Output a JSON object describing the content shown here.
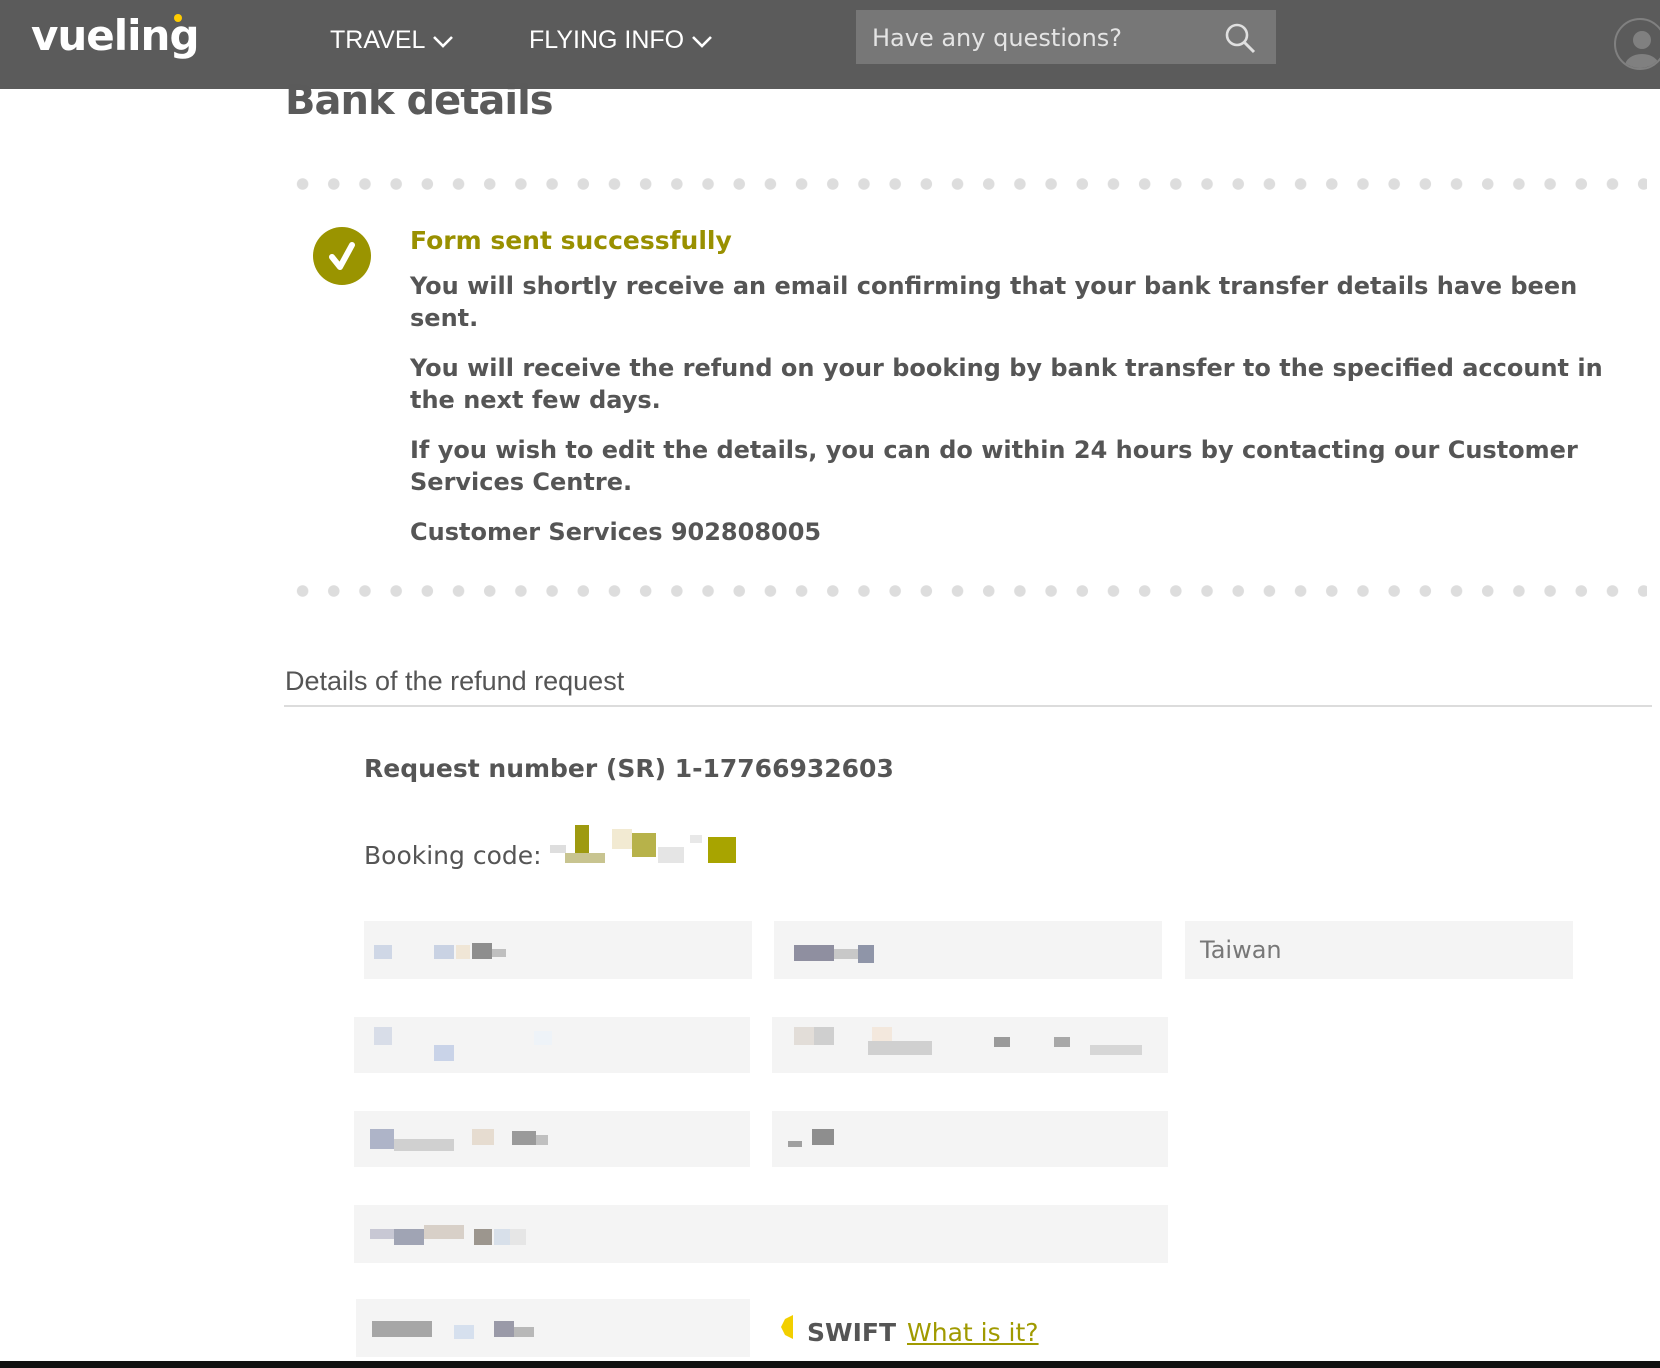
{
  "header": {
    "logo": "vueling",
    "nav": [
      {
        "label": "TRAVEL"
      },
      {
        "label": "FLYING INFO"
      }
    ],
    "search": {
      "placeholder": "Have any questions?"
    }
  },
  "page": {
    "title": "Bank details"
  },
  "confirmation": {
    "title": "Form sent successfully",
    "messages": [
      "You will shortly receive an email confirming that your bank transfer details have been sent.",
      "You will receive the refund on your booking by bank transfer to the specified account in the next few days.",
      "If you wish to edit the details, you can do within 24 hours by contacting our Customer Services Centre.",
      "Customer Services 902808005"
    ]
  },
  "refund": {
    "section_title": "Details of the refund request",
    "request_number": "Request number (SR) 1-17766932603",
    "booking_label": "Booking code:",
    "country_value": "Taiwan",
    "swift_label": "SWIFT",
    "swift_link": "What is it?"
  },
  "colors": {
    "header_bg": "#5b5b5b",
    "accent": "#9a9400",
    "logo_dot": "#ffcc00"
  }
}
